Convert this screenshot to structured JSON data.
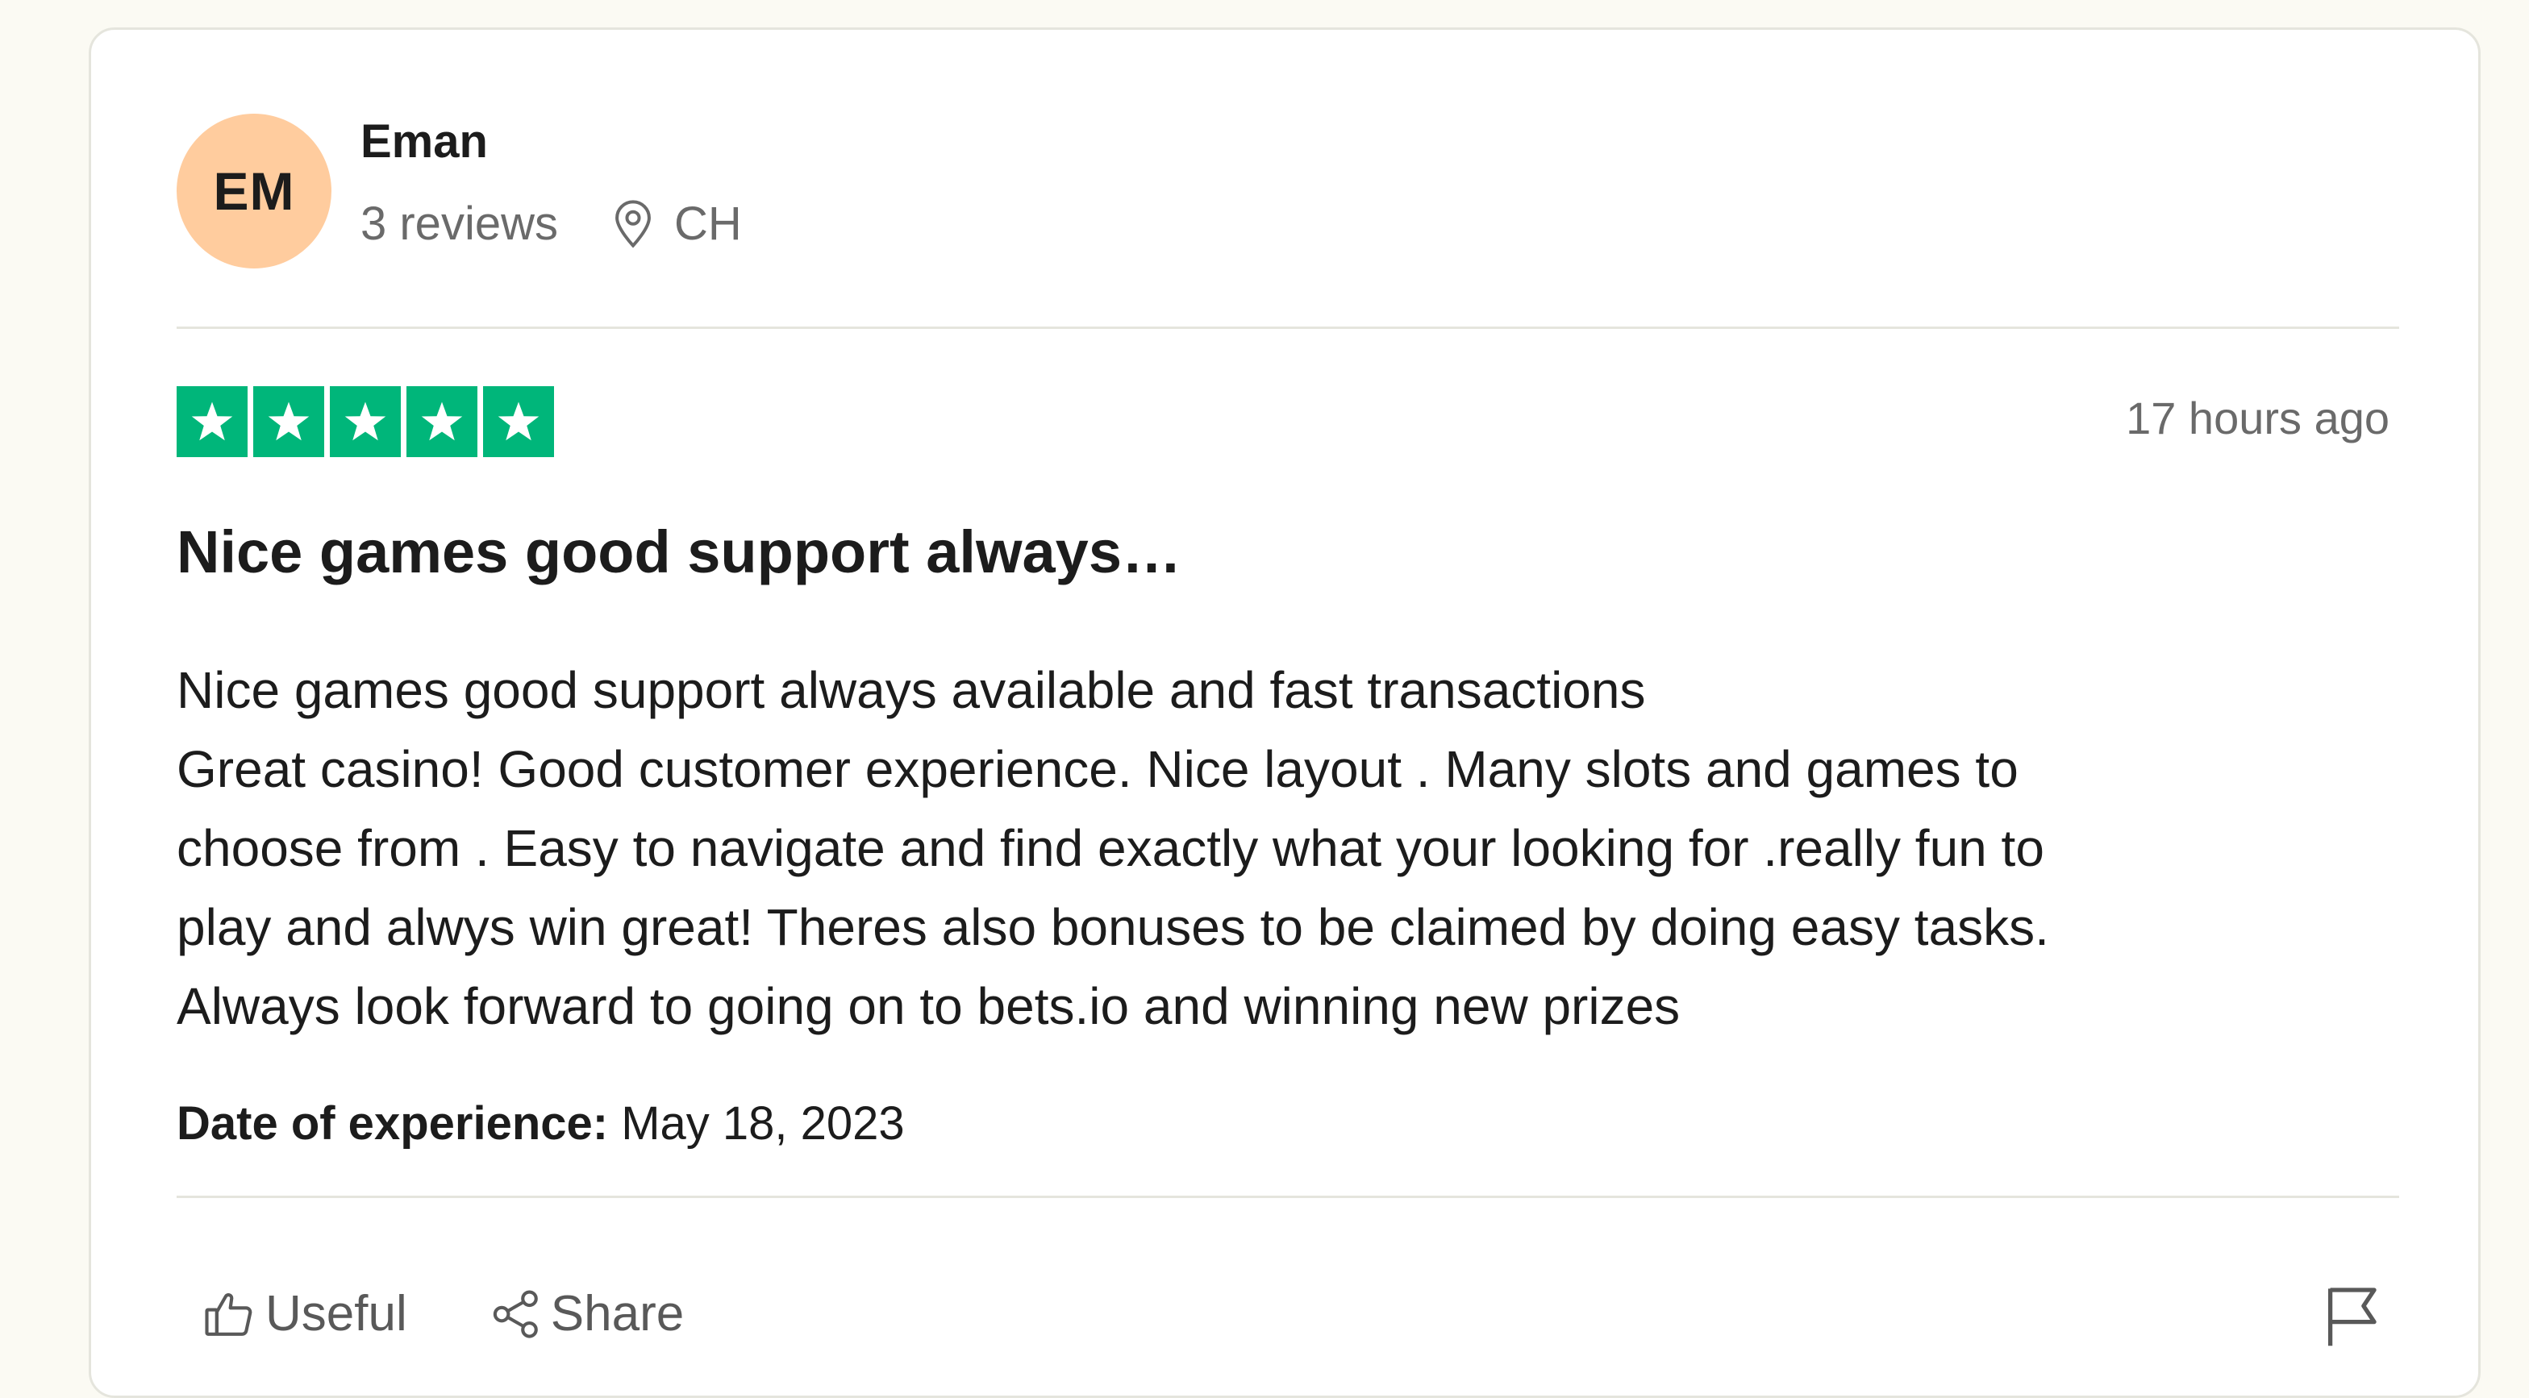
{
  "reviewer": {
    "initials": "EM",
    "name": "Eman",
    "review_count": "3 reviews",
    "location": "CH",
    "avatar_color": "#ffcc9e",
    "location_icon": "location-pin-icon"
  },
  "review": {
    "rating": 5,
    "rating_max": 5,
    "star_color": "#00b67a",
    "posted": "17 hours ago",
    "title": "Nice games good support always…",
    "body_lines": [
      "Nice games good support always available and fast transactions",
      "Great casino! Good customer experience. Nice layout . Many slots and games to",
      "choose from . Easy to navigate and find exactly what your looking for .really fun to",
      "play and alwys win great! Theres also bonuses to be claimed by doing easy tasks.",
      "Always look forward to going on to bets.io and winning new prizes"
    ],
    "experience_label": "Date of experience:",
    "experience_date": "May 18, 2023"
  },
  "actions": {
    "useful_label": "Useful",
    "useful_icon": "thumbs-up-icon",
    "share_label": "Share",
    "share_icon": "share-icon",
    "report_icon": "flag-icon"
  }
}
